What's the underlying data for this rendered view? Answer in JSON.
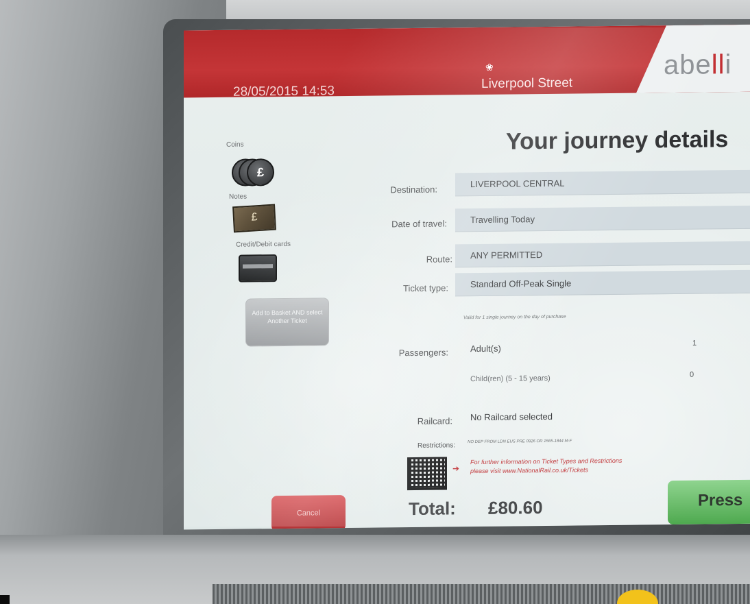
{
  "header": {
    "datetime": "28/05/2015  14:53",
    "station": "Liverpool Street",
    "brand": "abellio",
    "brand_visible_prefix": "abe",
    "brand_visible_accent": "ll",
    "brand_visible_suffix": "i",
    "accent_color": "#c43537"
  },
  "page": {
    "title": "Your journey details"
  },
  "payment": {
    "coins_label": "Coins",
    "notes_label": "Notes",
    "cards_label": "Credit/Debit cards",
    "currency_symbol": "£",
    "add_basket_label": "Add to Basket AND select Another Ticket"
  },
  "details": {
    "destination_label": "Destination:",
    "destination_value": "LIVERPOOL CENTRAL",
    "date_label": "Date of travel:",
    "date_value": "Travelling Today",
    "route_label": "Route:",
    "route_value": "ANY PERMITTED",
    "ticket_type_label": "Ticket type:",
    "ticket_type_value": "Standard Off-Peak Single",
    "ticket_note": "Valid for 1 single journey on the day of purchase",
    "passengers_label": "Passengers:",
    "adults_label": "Adult(s)",
    "adults_count": "1",
    "children_label": "Child(ren)   (5 - 15 years)",
    "children_count": "0",
    "railcard_label": "Railcard:",
    "railcard_value": "No Railcard selected",
    "restrictions_label": "Restrictions:",
    "restrictions_value": "NO DEP FROM LDN EUS PRE 0926 OR 1565-1844 M-F",
    "info_line1": "For further information on Ticket Types and Restrictions",
    "info_line2": "please visit www.NationalRail.co.uk/Tickets"
  },
  "footer": {
    "cancel_label": "Cancel",
    "total_label": "Total:",
    "total_value": "£80.60",
    "press_label": "Press"
  }
}
